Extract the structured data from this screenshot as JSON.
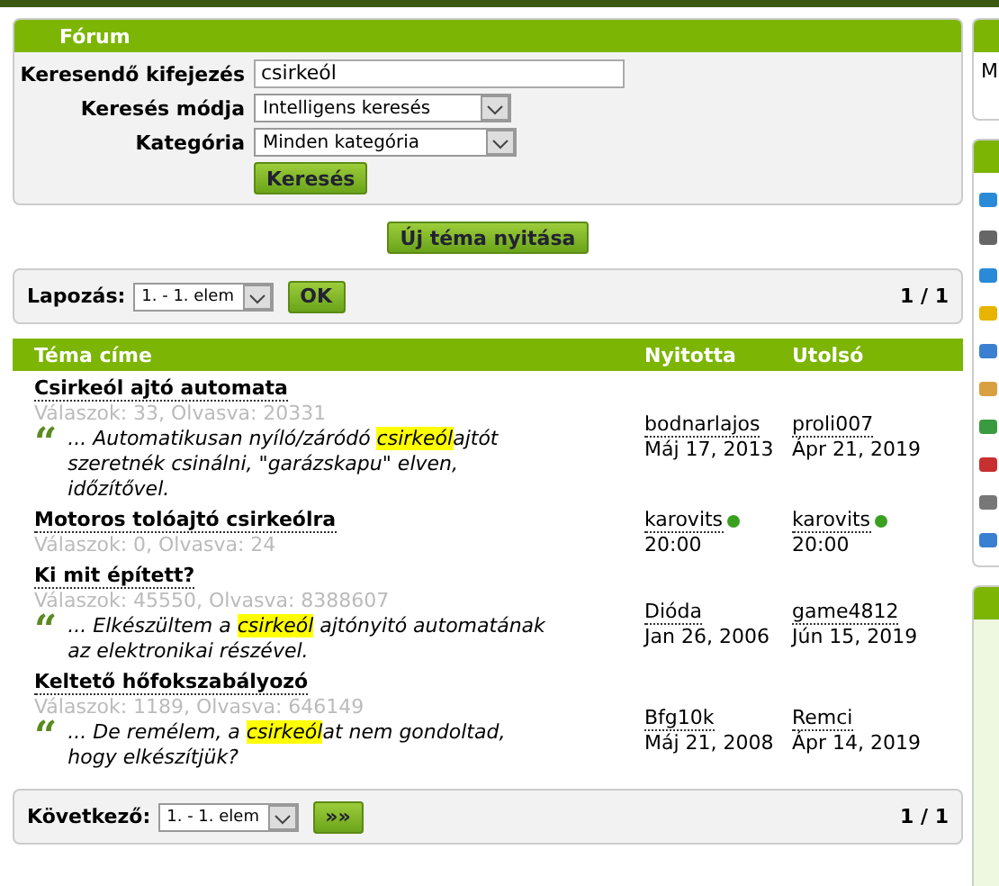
{
  "search_panel": {
    "title": "Fórum",
    "fields": [
      {
        "kind": "text",
        "label": "Keresendő kifejezés",
        "value": "csirkeól"
      },
      {
        "kind": "select",
        "label": "Keresés módja",
        "value": "Intelligens keresés"
      },
      {
        "kind": "select",
        "label": "Kategória",
        "value": "Minden kategória"
      }
    ],
    "submit": "Keresés"
  },
  "new_topic_button": "Új téma nyitása",
  "top_pager": {
    "label": "Lapozás:",
    "select": "1. - 1. elem",
    "button": "OK",
    "page": "1 / 1"
  },
  "table": {
    "columns": [
      "Téma címe",
      "Nyitotta",
      "Utolsó"
    ],
    "rows": [
      {
        "title": "Csirkeól ajtó automata",
        "stats": "Válaszok: 33, Olvasva: 20331",
        "quote": "“",
        "excerpt": [
          {
            "text": "... Automatikusan nyíló/záródó ",
            "highlighted": false
          },
          {
            "text": "csirkeól",
            "highlighted": true
          },
          {
            "text": "ajtót szeretnék csinálni, \"garázskapu\" elven, időzítővel.",
            "highlighted": false
          }
        ],
        "opener": {
          "name": "bodnarlajos",
          "online": false,
          "date": "Máj 17, 2013"
        },
        "last": {
          "name": "proli007",
          "online": false,
          "date": "Ápr 21, 2019"
        }
      },
      {
        "title": "Motoros tolóajtó csirkeólra",
        "stats": "Válaszok: 0, Olvasva: 24",
        "opener": {
          "name": "karovits",
          "online": true,
          "date": "20:00"
        },
        "last": {
          "name": "karovits",
          "online": true,
          "date": "20:00"
        }
      },
      {
        "title": "Ki mit épített?",
        "stats": "Válaszok: 45550, Olvasva: 8388607",
        "quote": "“",
        "excerpt": [
          {
            "text": "... Elkészültem a ",
            "highlighted": false
          },
          {
            "text": "csirkeól",
            "highlighted": true
          },
          {
            "text": " ajtónyitó automatának az elektronikai részével.",
            "highlighted": false
          }
        ],
        "opener": {
          "name": "Dióda",
          "online": false,
          "date": "Jan 26, 2006"
        },
        "last": {
          "name": "game4812",
          "online": false,
          "date": "Jún 15, 2019"
        }
      },
      {
        "title": "Keltető hőfokszabályozó",
        "stats": "Válaszok: 1189, Olvasva: 646149",
        "quote": "“",
        "excerpt": [
          {
            "text": "... De remélem, a ",
            "highlighted": false
          },
          {
            "text": "csirkeól",
            "highlighted": true
          },
          {
            "text": "at nem gondoltad, hogy elkészítjük?",
            "highlighted": false
          }
        ],
        "opener": {
          "name": "Bfg10k",
          "online": false,
          "date": "Máj 21, 2008"
        },
        "last": {
          "name": "Remci",
          "online": false,
          "date": "Ápr 14, 2019"
        }
      }
    ]
  },
  "bottom_pager": {
    "label": "Következő:",
    "select": "1. - 1. elem",
    "button": "»»",
    "page": "1 / 1"
  },
  "sidebar": {
    "panel_text": "M"
  }
}
